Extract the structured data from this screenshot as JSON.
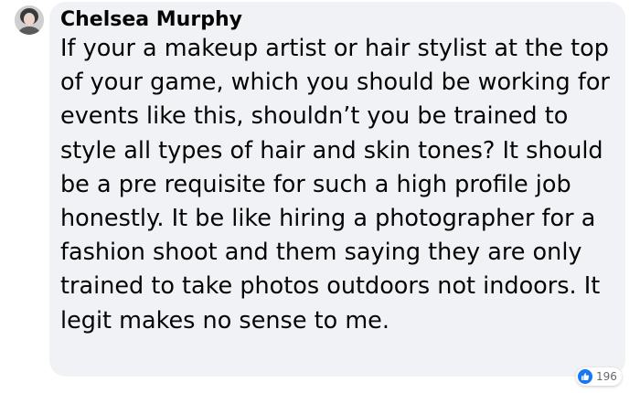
{
  "comment": {
    "author": "Chelsea Murphy",
    "text": "If your a makeup artist or hair stylist at the top of your game, which you should be working for events like this, shouldn’t you be trained to style all types of hair and skin tones? It should be a pre requisite for such a high profile job honestly. It be like hiring a photographer for a fashion shoot and them saying they are only trained to take photos outdoors not indoors. It legit makes no sense to me.",
    "reactions": {
      "icon": "like-icon",
      "count": "196"
    }
  },
  "colors": {
    "bubble_background": "#f0f2f5",
    "text": "#050505",
    "like_blue": "#1877f2",
    "count_grey": "#65676b"
  }
}
